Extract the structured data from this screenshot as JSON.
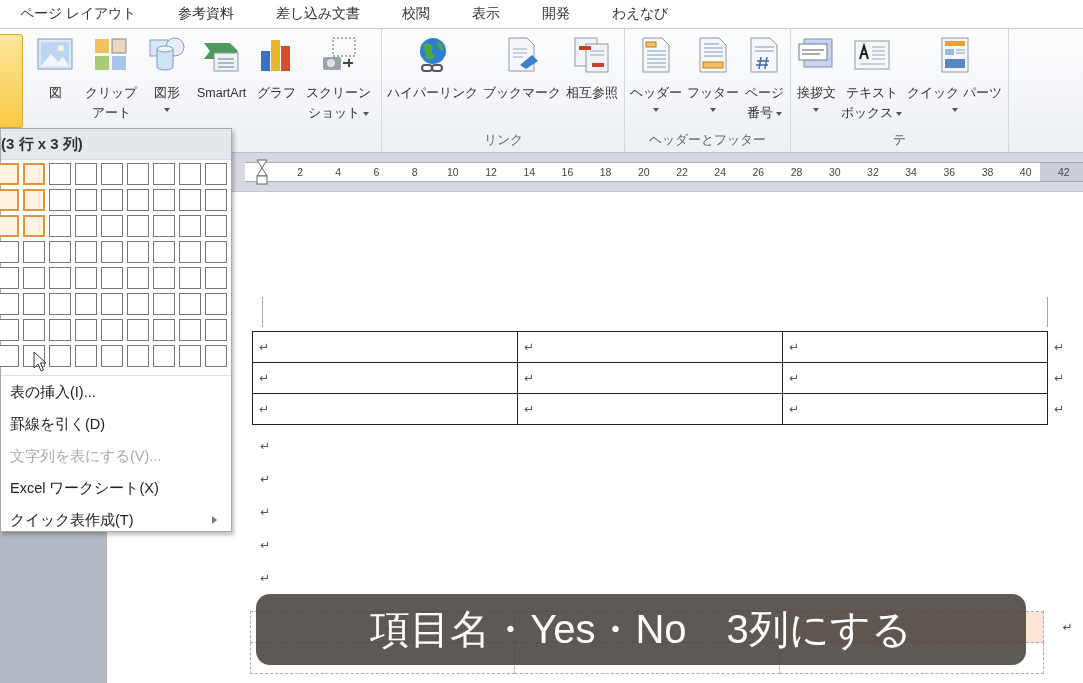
{
  "tabs": [
    {
      "label": "ページ レイアウト"
    },
    {
      "label": "参考資料"
    },
    {
      "label": "差し込み文書"
    },
    {
      "label": "校閲"
    },
    {
      "label": "表示"
    },
    {
      "label": "開発"
    },
    {
      "label": "わえなび"
    }
  ],
  "ribbon": {
    "table_button": {
      "selected": true
    },
    "groups": [
      {
        "items": [
          {
            "kind": "picture",
            "label": [
              "図"
            ],
            "dropdown": false
          },
          {
            "kind": "clipart",
            "label": [
              "クリップ",
              "アート"
            ],
            "dropdown": false
          },
          {
            "kind": "shapes",
            "label": [
              "図形"
            ],
            "dropdown": true
          },
          {
            "kind": "smartart",
            "label": [
              "SmartArt"
            ],
            "dropdown": false
          },
          {
            "kind": "chart",
            "label": [
              "グラフ"
            ],
            "dropdown": false
          },
          {
            "kind": "screenshot",
            "label": [
              "スクリーン",
              "ショット"
            ],
            "dropdown": true
          }
        ]
      },
      {
        "label": "リンク",
        "items": [
          {
            "kind": "hyperlink",
            "label": [
              "ハイパーリンク"
            ],
            "dropdown": false
          },
          {
            "kind": "bookmark",
            "label": [
              "ブックマーク"
            ],
            "dropdown": false
          },
          {
            "kind": "crossref",
            "label": [
              "相互参照"
            ],
            "dropdown": false
          }
        ]
      },
      {
        "label": "ヘッダーとフッター",
        "items": [
          {
            "kind": "header",
            "label": [
              "ヘッダー"
            ],
            "dropdown": true
          },
          {
            "kind": "footer",
            "label": [
              "フッター"
            ],
            "dropdown": true
          },
          {
            "kind": "pagenumber",
            "label": [
              "ページ",
              "番号"
            ],
            "dropdown": true
          }
        ]
      },
      {
        "label": "テ",
        "items": [
          {
            "kind": "greeting",
            "label": [
              "挨拶文"
            ],
            "dropdown": true
          },
          {
            "kind": "textbox",
            "label": [
              "テキスト",
              "ボックス"
            ],
            "dropdown": true
          },
          {
            "kind": "quickparts",
            "label": [
              "クイック パーツ"
            ],
            "dropdown": true
          }
        ]
      }
    ]
  },
  "ruler": {
    "labels": [
      "2",
      "4",
      "6",
      "8",
      "10",
      "12",
      "14",
      "16",
      "18",
      "20",
      "22",
      "24",
      "26",
      "28",
      "30",
      "32",
      "34",
      "36",
      "38",
      "40",
      "42"
    ]
  },
  "dropdown": {
    "title": "(3 行 x 3 列)",
    "grid": [
      [
        {
          "selected": true
        },
        {
          "selected": true
        },
        {
          "selected": false
        },
        {
          "selected": false
        },
        {
          "selected": false
        },
        {
          "selected": false
        },
        {
          "selected": false
        },
        {
          "selected": false
        },
        {
          "selected": false
        }
      ],
      [
        {
          "selected": true
        },
        {
          "selected": true
        },
        {
          "selected": false
        },
        {
          "selected": false
        },
        {
          "selected": false
        },
        {
          "selected": false
        },
        {
          "selected": false
        },
        {
          "selected": false
        },
        {
          "selected": false
        }
      ],
      [
        {
          "selected": true
        },
        {
          "selected": true
        },
        {
          "selected": false
        },
        {
          "selected": false
        },
        {
          "selected": false
        },
        {
          "selected": false
        },
        {
          "selected": false
        },
        {
          "selected": false
        },
        {
          "selected": false
        }
      ],
      [
        {
          "selected": false
        },
        {
          "selected": false
        },
        {
          "selected": false
        },
        {
          "selected": false
        },
        {
          "selected": false
        },
        {
          "selected": false
        },
        {
          "selected": false
        },
        {
          "selected": false
        },
        {
          "selected": false
        }
      ],
      [
        {
          "selected": false
        },
        {
          "selected": false
        },
        {
          "selected": false
        },
        {
          "selected": false
        },
        {
          "selected": false
        },
        {
          "selected": false
        },
        {
          "selected": false
        },
        {
          "selected": false
        },
        {
          "selected": false
        }
      ],
      [
        {
          "selected": false
        },
        {
          "selected": false
        },
        {
          "selected": false
        },
        {
          "selected": false
        },
        {
          "selected": false
        },
        {
          "selected": false
        },
        {
          "selected": false
        },
        {
          "selected": false
        },
        {
          "selected": false
        }
      ],
      [
        {
          "selected": false
        },
        {
          "selected": false
        },
        {
          "selected": false
        },
        {
          "selected": false
        },
        {
          "selected": false
        },
        {
          "selected": false
        },
        {
          "selected": false
        },
        {
          "selected": false
        },
        {
          "selected": false
        }
      ],
      [
        {
          "selected": false
        },
        {
          "selected": false
        },
        {
          "selected": false
        },
        {
          "selected": false
        },
        {
          "selected": false
        },
        {
          "selected": false
        },
        {
          "selected": false
        },
        {
          "selected": false
        },
        {
          "selected": false
        }
      ]
    ],
    "items": [
      {
        "label": "表の挿入(I)...",
        "disabled": false,
        "submenu": false
      },
      {
        "label": "罫線を引く(D)",
        "disabled": false,
        "submenu": false
      },
      {
        "label": "文字列を表にする(V)...",
        "disabled": true,
        "submenu": false
      },
      {
        "label": "Excel ワークシート(X)",
        "disabled": false,
        "submenu": false
      },
      {
        "label": "クイック表作成(T)",
        "disabled": false,
        "submenu": true
      }
    ]
  },
  "document": {
    "table": {
      "rows": [
        {
          "cells": [
            "↵",
            "↵",
            "↵"
          ],
          "end": "↵"
        },
        {
          "cells": [
            "↵",
            "↵",
            "↵"
          ],
          "end": "↵"
        },
        {
          "cells": [
            "↵",
            "↵",
            "↵"
          ],
          "end": "↵"
        }
      ]
    },
    "paragraphs": [
      "↵",
      "↵",
      "↵",
      "↵",
      "↵"
    ],
    "example_table": {
      "end": "↵"
    }
  },
  "caption": "項目名・Yes・No　3列にする"
}
